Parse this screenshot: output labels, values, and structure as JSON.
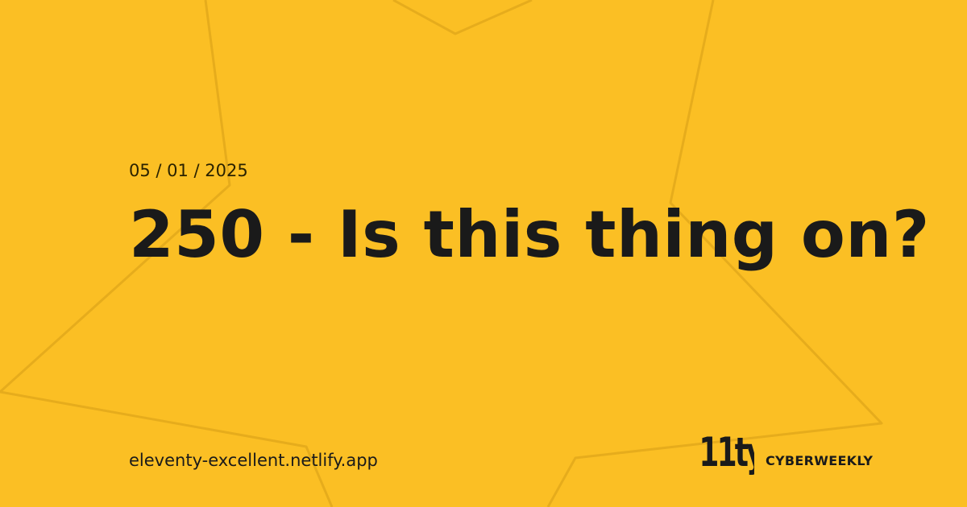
{
  "card": {
    "background_color": "#fbbf24",
    "decoration_color": "#e6ac1c",
    "text_color": "#1a1a1a",
    "decoration_icon": "star-outline-icon",
    "date": "05 / 01 / 2025",
    "title": "250 - Is this thing on?",
    "site_url": "eleventy-excellent.netlify.app",
    "logo_text": "11ty",
    "brand": "CYBERWEEKLY"
  }
}
